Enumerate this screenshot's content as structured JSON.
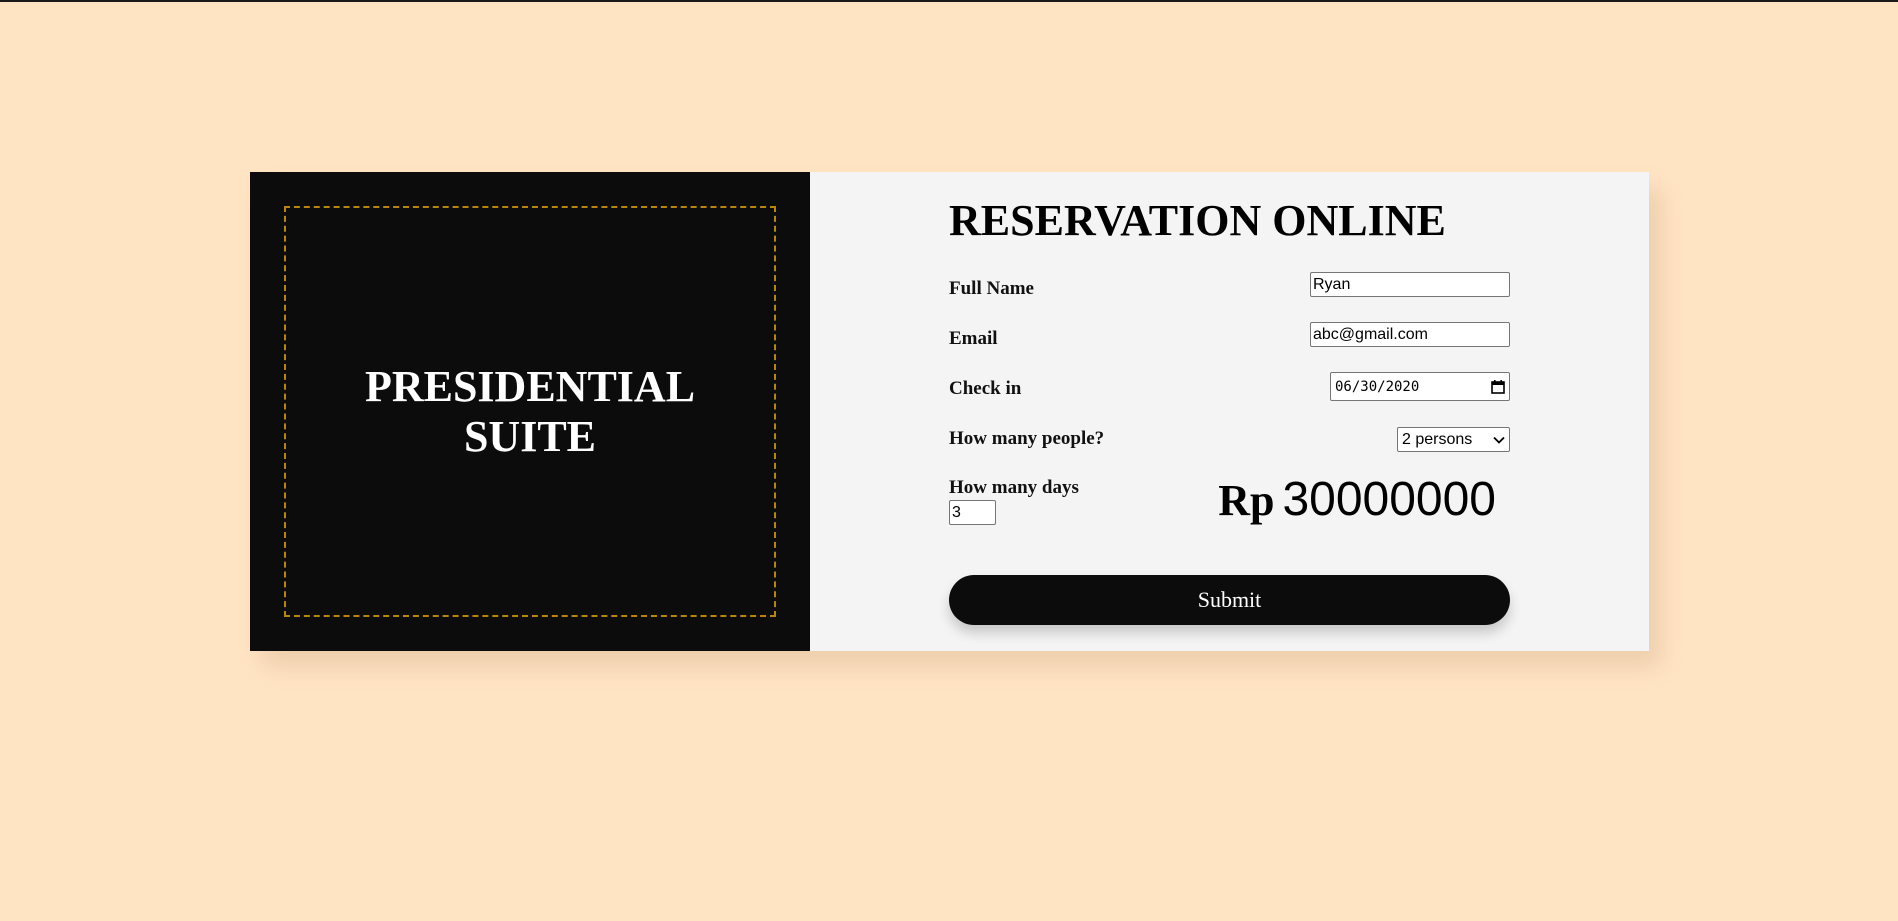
{
  "suite": {
    "title": "PRESIDENTIAL SUITE"
  },
  "form": {
    "title": "RESERVATION ONLINE",
    "full_name": {
      "label": "Full Name",
      "value": "Ryan"
    },
    "email": {
      "label": "Email",
      "value": "abc@gmail.com"
    },
    "check_in": {
      "label": "Check in",
      "value": "06/30/2020"
    },
    "people": {
      "label": "How many people?",
      "selected": "2 persons"
    },
    "days": {
      "label": "How many days",
      "value": "3"
    },
    "price": {
      "currency": "Rp",
      "amount": "30000000"
    },
    "submit_label": "Submit"
  },
  "colors": {
    "page_background": "#ffe4c4",
    "left_panel": "#0c0c0c",
    "frame_border": "#b8860b",
    "right_panel": "#f4f4f4"
  },
  "icons": {
    "calendar": "calendar-icon",
    "dropdown": "chevron-down-icon"
  }
}
